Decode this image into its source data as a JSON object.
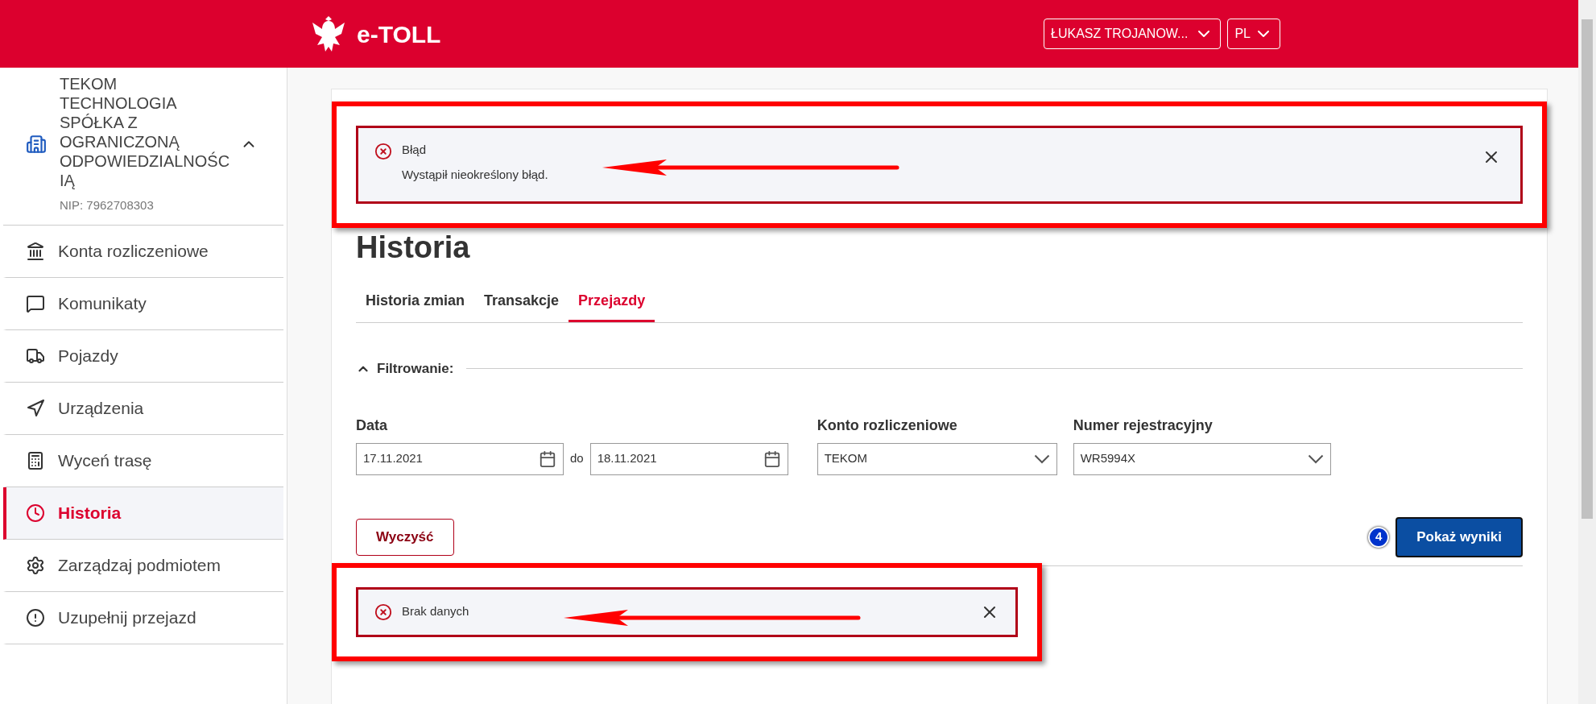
{
  "header": {
    "logo_text": "e-TOLL",
    "user_menu": "ŁUKASZ TROJANOW...",
    "language": "PL"
  },
  "sidebar": {
    "company": {
      "name": "TEKOM TECHNOLOGIA SPÓŁKA Z OGRANICZONĄ ODPOWIEDZIALNOŚC IĄ",
      "nip": "NIP: 7962708303",
      "expanded": true
    },
    "items": [
      {
        "label": "Konta rozliczeniowe",
        "selected": false
      },
      {
        "label": "Komunikaty",
        "selected": false
      },
      {
        "label": "Pojazdy",
        "selected": false
      },
      {
        "label": "Urządzenia",
        "selected": false
      },
      {
        "label": "Wyceń trasę",
        "selected": false
      },
      {
        "label": "Historia",
        "selected": true
      },
      {
        "label": "Zarządzaj podmiotem",
        "selected": false
      },
      {
        "label": "Uzupełnij przejazd",
        "selected": false
      }
    ]
  },
  "error_alert": {
    "title": "Błąd",
    "message": "Wystąpił nieokreślony błąd."
  },
  "heading": "Historia",
  "tabs": [
    {
      "label": "Historia zmian",
      "selected": false
    },
    {
      "label": "Transakcje",
      "selected": false
    },
    {
      "label": "Przejazdy",
      "selected": true
    }
  ],
  "filter": {
    "title": "Filtrowanie:",
    "expanded": true,
    "date": {
      "label": "Data",
      "from": "17.11.2021",
      "separator": "do",
      "to": "18.11.2021"
    },
    "account": {
      "label": "Konto rozliczeniowe",
      "value": "TEKOM"
    },
    "plate": {
      "label": "Numer rejestracyjny",
      "value": "WR5994X"
    }
  },
  "buttons": {
    "clear": "Wyczyść",
    "submit": "Pokaż wyniki",
    "step_badge": "4"
  },
  "no_data_alert": {
    "message": "Brak danych"
  }
}
